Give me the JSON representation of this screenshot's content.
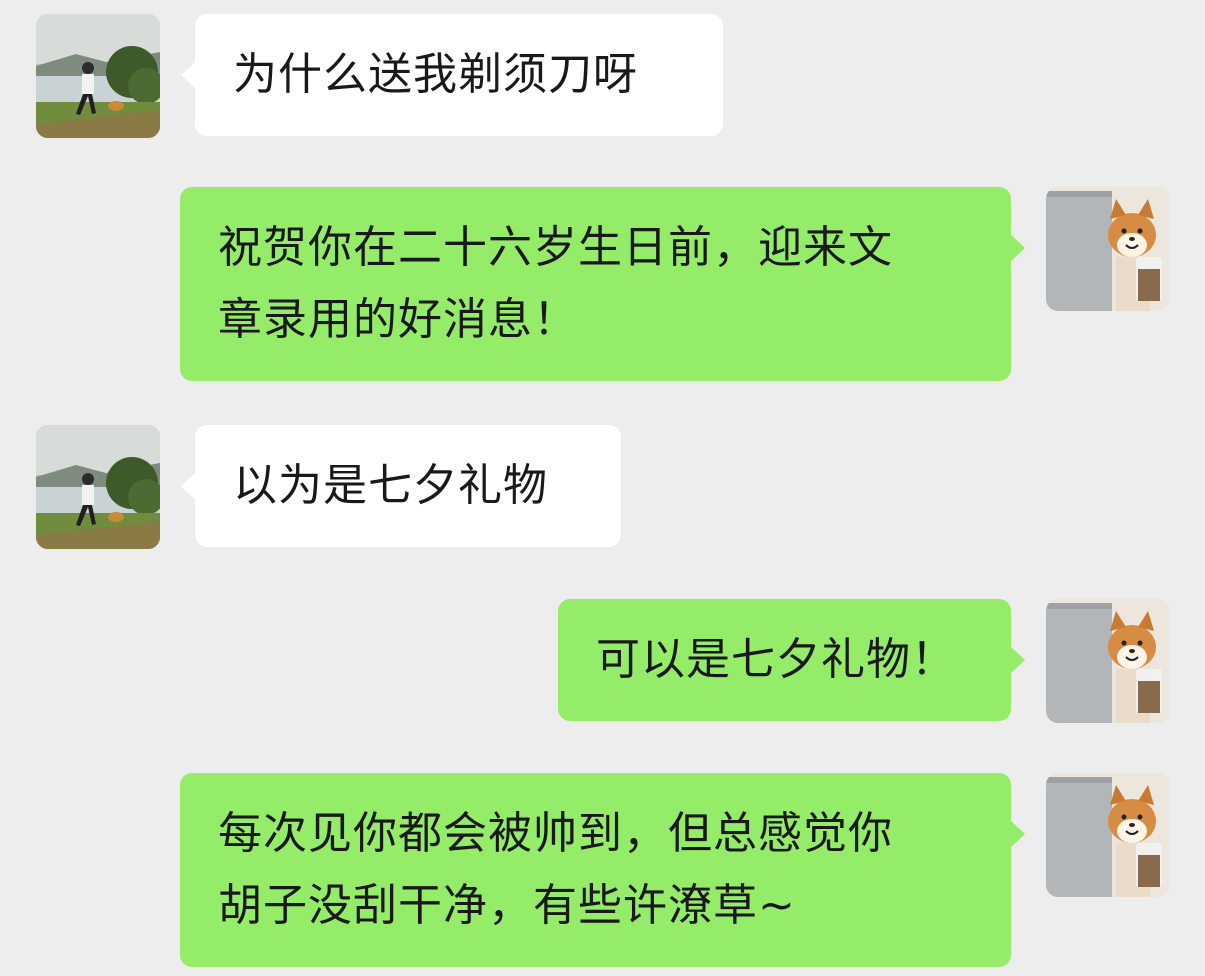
{
  "chat": {
    "messages": [
      {
        "side": "left",
        "avatar": "man-with-dog-avatar",
        "lines": [
          "为什么送我剃须刀呀"
        ]
      },
      {
        "side": "right",
        "avatar": "shiba-dog-avatar",
        "lines": [
          "祝贺你在二十六岁生日前，迎来文",
          "章录用的好消息！"
        ]
      },
      {
        "side": "left",
        "avatar": "man-with-dog-avatar",
        "lines": [
          "以为是七夕礼物"
        ]
      },
      {
        "side": "right",
        "avatar": "shiba-dog-avatar",
        "lines": [
          "可以是七夕礼物！"
        ]
      },
      {
        "side": "right",
        "avatar": "shiba-dog-avatar",
        "lines": [
          "每次见你都会被帅到，但总感觉你",
          "胡子没刮干净，有些许潦草~"
        ]
      }
    ]
  },
  "colors": {
    "background": "#ededed",
    "incoming_bubble": "#ffffff",
    "outgoing_bubble": "#95ec69"
  }
}
